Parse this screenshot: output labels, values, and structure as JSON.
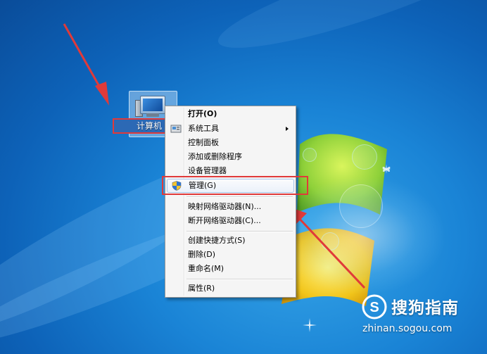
{
  "desktop": {
    "icon_label": "计算机"
  },
  "context_menu": {
    "items": [
      {
        "label": "打开(O)",
        "bold": true
      },
      {
        "label": "系统工具",
        "submenu": true
      },
      {
        "label": "控制面板"
      },
      {
        "label": "添加或删除程序"
      },
      {
        "label": "设备管理器"
      },
      {
        "label": "管理(G)",
        "highlighted": true,
        "icon": "shield-icon"
      },
      {
        "label": "映射网络驱动器(N)..."
      },
      {
        "label": "断开网络驱动器(C)..."
      },
      {
        "label": "创建快捷方式(S)"
      },
      {
        "label": "删除(D)"
      },
      {
        "label": "重命名(M)"
      },
      {
        "label": "属性(R)"
      }
    ]
  },
  "annotations": {
    "color": "#e03a3a"
  },
  "watermark": {
    "brand": "搜狗指南",
    "url": "zhinan.sogou.com",
    "logo_letter": "S"
  },
  "colors": {
    "desktop_bg": "#1a84d6",
    "menu_bg": "#f5f5f5",
    "highlight_border": "#a8c4e8"
  }
}
